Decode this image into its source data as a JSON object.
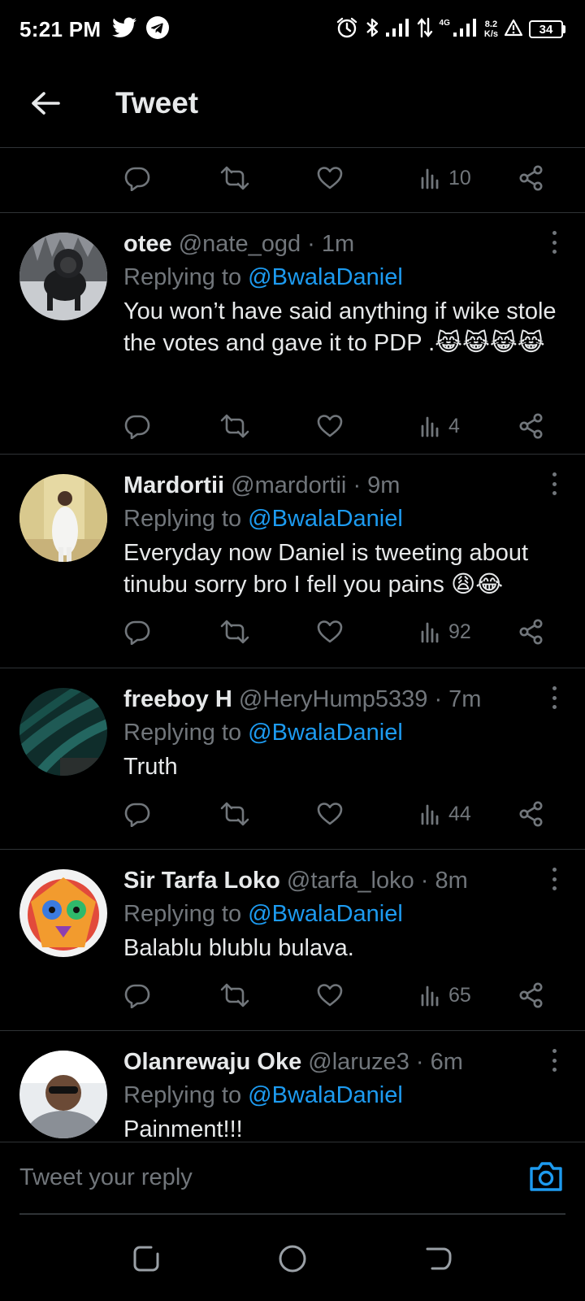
{
  "status_bar": {
    "time": "5:21 PM",
    "left_icons": [
      "twitter-icon",
      "telegram-icon"
    ],
    "right_icons": [
      "alarm-icon",
      "bluetooth-icon",
      "signal-icon",
      "data-arrows-icon",
      "signal-4g-icon",
      "warning-icon"
    ],
    "network": "4G",
    "speed_value": "8.2",
    "speed_unit": "K/s",
    "battery": "34"
  },
  "header": {
    "title": "Tweet"
  },
  "top_actions": {
    "views": "10"
  },
  "tweets": [
    {
      "name": "otee",
      "handle": "@nate_ogd",
      "time": "1m",
      "replying_prefix": "Replying to",
      "replying_to": "@BwalaDaniel",
      "text": "You won’t have said anything if wike stole the votes and gave it to PDP .😹😹😹😹",
      "views": "4"
    },
    {
      "name": "Mardortii",
      "handle": "@mardortii",
      "time": "9m",
      "replying_prefix": "Replying to",
      "replying_to": "@BwalaDaniel",
      "text": "Everyday now Daniel is tweeting about tinubu sorry bro I fell you pains 😩😂",
      "views": "92"
    },
    {
      "name": "freeboy H",
      "handle": "@HeryHump5339",
      "time": "7m",
      "replying_prefix": "Replying to",
      "replying_to": "@BwalaDaniel",
      "text": "Truth",
      "views": "44"
    },
    {
      "name": "Sir Tarfa Loko",
      "handle": "@tarfa_loko",
      "time": "8m",
      "replying_prefix": "Replying to",
      "replying_to": "@BwalaDaniel",
      "text": "Balablu blublu bulava.",
      "views": "65"
    },
    {
      "name": "Olanrewaju Oke",
      "handle": "@laruze3",
      "time": "6m",
      "replying_prefix": "Replying to",
      "replying_to": "@BwalaDaniel",
      "text": "Painment!!!"
    }
  ],
  "reply_bar": {
    "placeholder": "Tweet your reply"
  },
  "colors": {
    "background": "#000000",
    "text": "#e7e9ea",
    "muted": "#71767b",
    "accent": "#1d9bf0",
    "divider": "#2f3336"
  }
}
